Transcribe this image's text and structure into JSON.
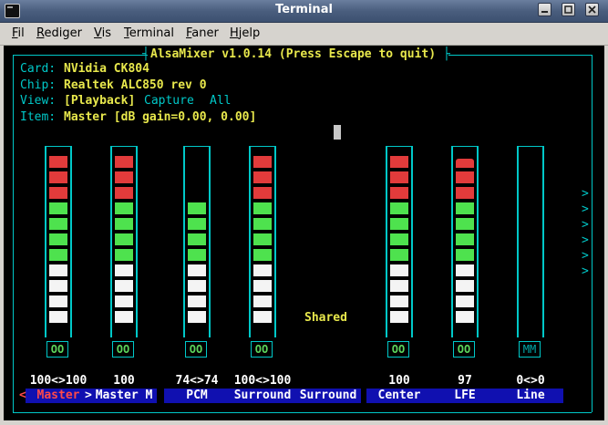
{
  "window": {
    "title": "Terminal"
  },
  "menu": [
    {
      "key": "F",
      "rest": "il"
    },
    {
      "key": "R",
      "rest": "ediger"
    },
    {
      "key": "V",
      "rest": "is"
    },
    {
      "key": "T",
      "rest": "erminal"
    },
    {
      "key": "F",
      "rest": "aner"
    },
    {
      "key": "H",
      "rest": "jelp"
    }
  ],
  "alsamixer": {
    "title": "AlsaMixer v1.0.14 (Press Escape to quit)",
    "card_label": "Card:",
    "card": "NVidia CK804",
    "chip_label": "Chip:",
    "chip": "Realtek ALC850 rev 0",
    "view_label": "View:",
    "view_playback": "[Playback]",
    "view_capture": "Capture",
    "view_all": "All",
    "item_label": "Item:",
    "item": "Master [dB gain=0.00, 0.00]",
    "shared": "Shared",
    "selected_left": "<",
    "selected_right": ">",
    "more_arrow": ">"
  },
  "channels": [
    {
      "name": "Master",
      "volume": "100<>100",
      "mute": "OO",
      "level": 1.0,
      "selected": true
    },
    {
      "name": "Master M",
      "volume": "100",
      "mute": "OO",
      "level": 1.0
    },
    {
      "name": "PCM",
      "volume": "74<>74",
      "mute": "OO",
      "level": 0.74
    },
    {
      "name": "Surround",
      "volume": "100<>100",
      "mute": "OO",
      "level": 1.0
    },
    {
      "name": "Surround",
      "volume": "",
      "mute": "",
      "level": null
    },
    {
      "name": "Center",
      "volume": "100",
      "mute": "OO",
      "level": 1.0
    },
    {
      "name": "LFE",
      "volume": "97",
      "mute": "OO",
      "level": 0.97
    },
    {
      "name": "Line",
      "volume": "0<>0",
      "mute": "MM",
      "level": 0.0
    }
  ],
  "colors": {
    "frame": "#00c8c8",
    "header_value": "#e8e84c",
    "label_bg": "#1010b0",
    "selected_label": "#ff4a4a",
    "high": "#e23b3b",
    "mid": "#4ee24e",
    "low": "#f4f4f4"
  }
}
